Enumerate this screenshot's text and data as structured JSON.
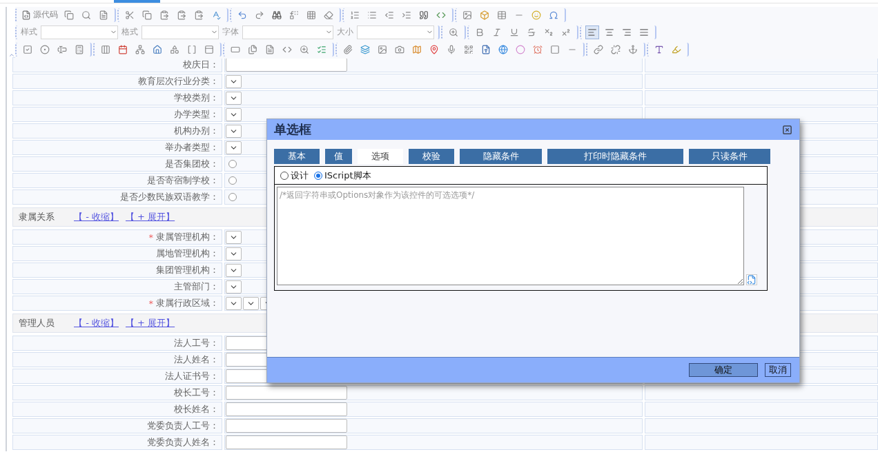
{
  "toolbar": {
    "source_label": "源代码",
    "dropdowns": [
      {
        "label": "样式"
      },
      {
        "label": "格式"
      },
      {
        "label": "字体"
      },
      {
        "label": "大小"
      }
    ],
    "alignment": [
      {
        "selected": true
      },
      {
        "selected": false
      },
      {
        "selected": false
      },
      {
        "selected": false
      }
    ]
  },
  "sections": [
    {
      "rows": [
        {
          "kind": "input",
          "label": "校庆日："
        },
        {
          "kind": "select",
          "label": "教育层次行业分类："
        },
        {
          "kind": "select",
          "label": "学校类别："
        },
        {
          "kind": "select",
          "label": "办学类型："
        },
        {
          "kind": "select",
          "label": "机构办别："
        },
        {
          "kind": "select",
          "label": "举办者类型："
        },
        {
          "kind": "radio",
          "label": "是否集团校：",
          "checked": false
        },
        {
          "kind": "radio",
          "label": "是否寄宿制学校：",
          "checked": false
        },
        {
          "kind": "radio",
          "label": "是否少数民族双语教学：",
          "checked": false
        }
      ]
    },
    {
      "title": "隶属关系",
      "links": [
        "【 - 收缩】",
        "【 + 展开】"
      ],
      "rows": [
        {
          "kind": "select",
          "label": "隶属管理机构：",
          "required_mark": "*"
        },
        {
          "kind": "select",
          "label": "属地管理机构："
        },
        {
          "kind": "select",
          "label": "集团管理机构："
        },
        {
          "kind": "select",
          "label": "主管部门："
        },
        {
          "kind": "region",
          "label": "隶属行政区域：",
          "required_mark": "*"
        }
      ]
    },
    {
      "title": "管理人员",
      "links": [
        "【 - 收缩】",
        "【 + 展开】"
      ],
      "rows": [
        {
          "kind": "input",
          "label": "法人工号："
        },
        {
          "kind": "input",
          "label": "法人姓名："
        },
        {
          "kind": "input",
          "label": "法人证书号："
        },
        {
          "kind": "input",
          "label": "校长工号："
        },
        {
          "kind": "input",
          "label": "校长姓名："
        },
        {
          "kind": "input",
          "label": "党委负责人工号："
        },
        {
          "kind": "input",
          "label": "党委负责人姓名："
        }
      ]
    }
  ],
  "dialog": {
    "title": "单选框",
    "tabs": [
      {
        "label": "基本",
        "selected": false
      },
      {
        "label": "值",
        "selected": false
      },
      {
        "label": "选项",
        "selected": true
      },
      {
        "label": "校验",
        "selected": false
      },
      {
        "label": "隐藏条件",
        "selected": false
      },
      {
        "label": "打印时隐藏条件",
        "selected": false
      },
      {
        "label": "只读条件",
        "selected": false
      }
    ],
    "modes": [
      {
        "label": "设计",
        "selected": false
      },
      {
        "label": "IScript脚本",
        "selected": true
      }
    ],
    "script": {
      "placeholder": "/*返回字符串或Options对象作为该控件的可选选项*/"
    },
    "buttons": [
      {
        "label": "确定",
        "kind": "primary"
      },
      {
        "label": "取消",
        "kind": "secondary"
      }
    ]
  }
}
